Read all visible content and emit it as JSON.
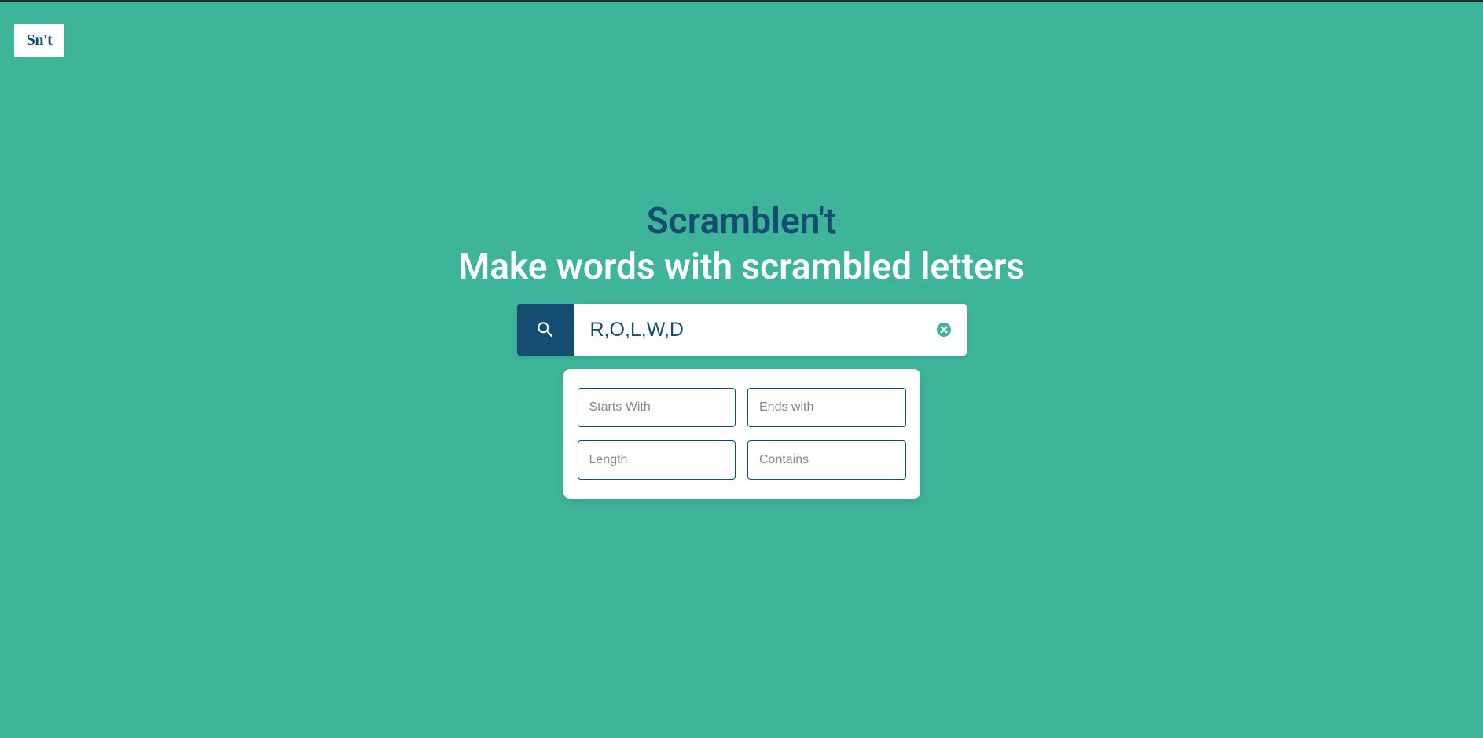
{
  "logo": {
    "text": "Sn't"
  },
  "hero": {
    "title": "Scramblen't",
    "subtitle": "Make words with scrambled letters"
  },
  "search": {
    "value": "R,O,L,W,D"
  },
  "filters": {
    "starts_with": {
      "placeholder": "Starts With",
      "value": ""
    },
    "ends_with": {
      "placeholder": "Ends with",
      "value": ""
    },
    "length": {
      "placeholder": "Length",
      "value": ""
    },
    "contains": {
      "placeholder": "Contains",
      "value": ""
    }
  }
}
